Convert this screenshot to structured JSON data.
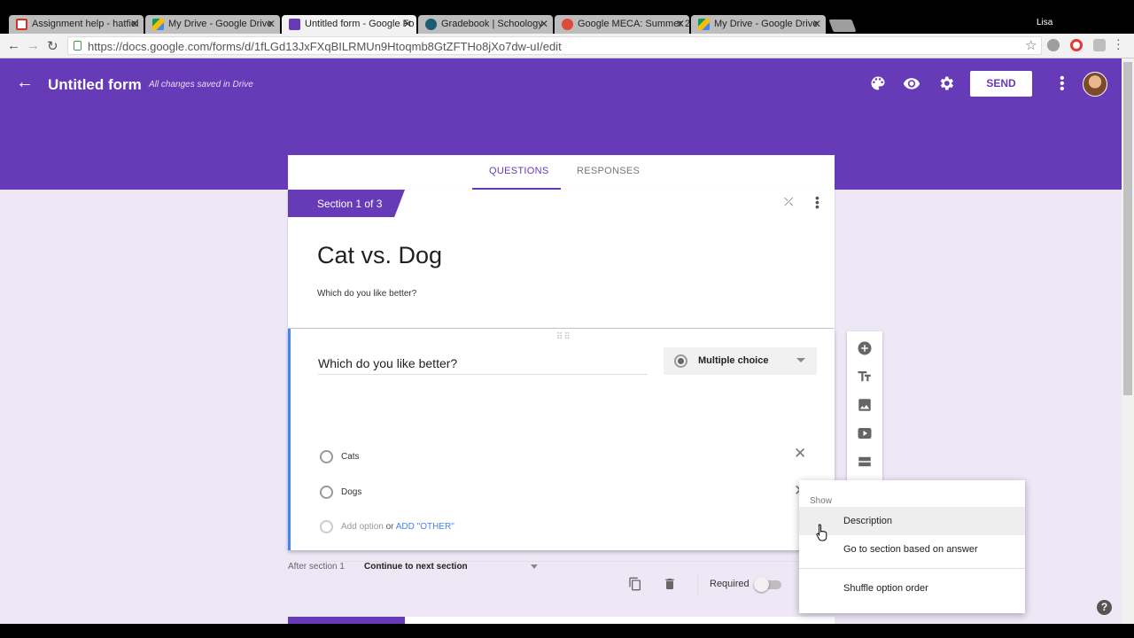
{
  "browser": {
    "tabs": [
      {
        "label": "Assignment help - hatfiel",
        "active": false,
        "favicon_color": "#d93025"
      },
      {
        "label": "My Drive - Google Drive",
        "active": false,
        "favicon_color": "#fbbc04"
      },
      {
        "label": "Untitled form - Google Fo",
        "active": true,
        "favicon_color": "#673ab7"
      },
      {
        "label": "Gradebook | Schoology",
        "active": false,
        "favicon_color": "#1b5e74"
      },
      {
        "label": "Google MECA: Summer 2",
        "active": false,
        "favicon_color": "#dd4b39"
      },
      {
        "label": "My Drive - Google Drive",
        "active": false,
        "favicon_color": "#fbbc04"
      }
    ],
    "user": "Lisa",
    "url": "https://docs.google.com/forms/d/1fLGd13JxFXqBILRMUn9Htoqmb8GtZFTHo8jXo7dw-uI/edit"
  },
  "header": {
    "title": "Untitled form",
    "save_status": "All changes saved in Drive",
    "send_label": "SEND",
    "theme_color": "#673ab7"
  },
  "form_tabs": {
    "questions": "QUESTIONS",
    "responses": "RESPONSES"
  },
  "section": {
    "label": "Section 1 of 3",
    "title": "Cat vs. Dog",
    "description": "Which do you like better?"
  },
  "question": {
    "title": "Which do you like better?",
    "type": "Multiple choice",
    "options": [
      "Cats",
      "Dogs"
    ],
    "add_option": "Add option",
    "or": "or",
    "add_other": "ADD \"OTHER\"",
    "required_label": "Required",
    "required": false
  },
  "after_section": {
    "label": "After section 1",
    "value": "Continue to next section"
  },
  "menu": {
    "header": "Show",
    "items": [
      "Description",
      "Go to section based on answer",
      "Shuffle option order"
    ],
    "hovered": "Description"
  }
}
